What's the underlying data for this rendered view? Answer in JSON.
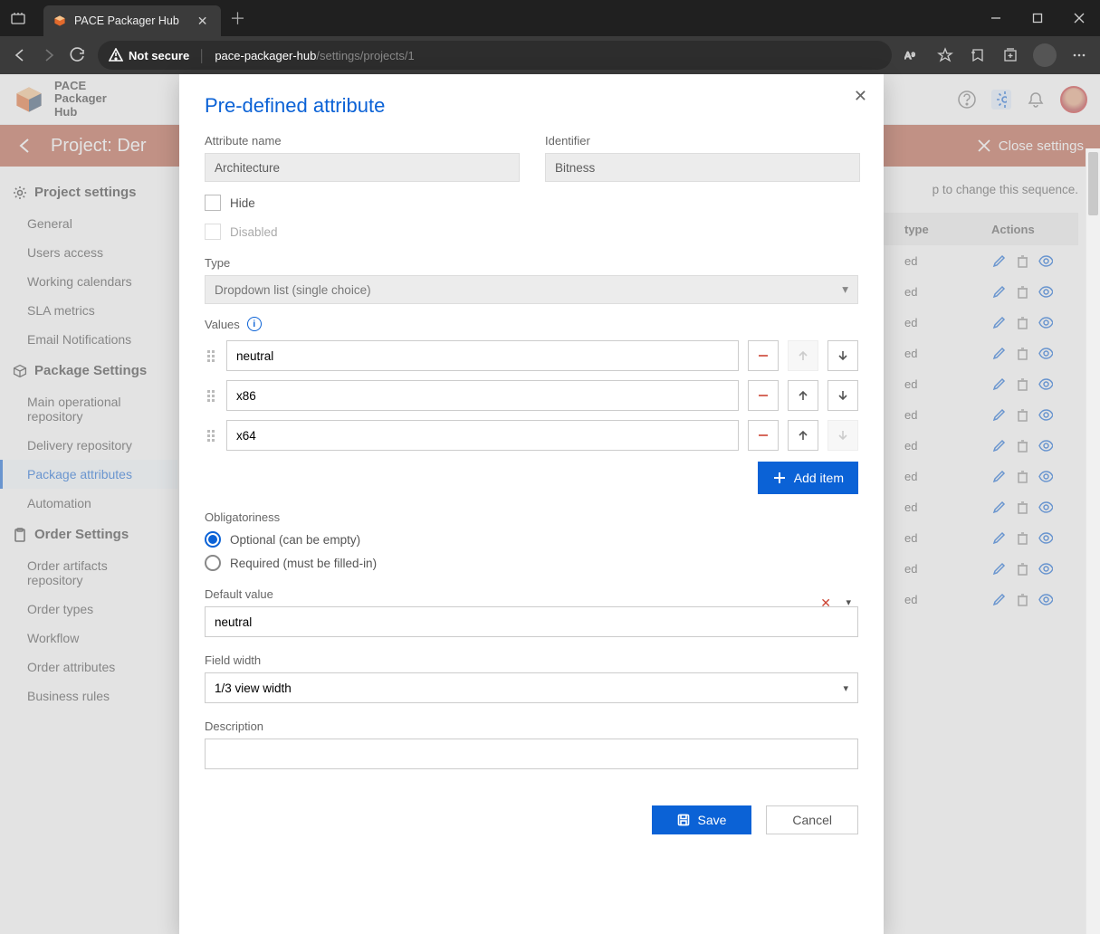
{
  "browser": {
    "tab_title": "PACE Packager Hub",
    "not_secure_label": "Not secure",
    "url_host": "pace-packager-hub",
    "url_path": "/settings/projects/1"
  },
  "app_header": {
    "logo_line1": "PACE",
    "logo_line2": "Packager",
    "logo_line3": "Hub"
  },
  "orange_bar": {
    "title": "Project: Der",
    "close_label": "Close settings"
  },
  "sidebar": {
    "sections": [
      {
        "title": "Project settings",
        "items": [
          "General",
          "Users access",
          "Working calendars",
          "SLA metrics",
          "Email Notifications"
        ]
      },
      {
        "title": "Package Settings",
        "items": [
          "Main operational repository",
          "Delivery repository",
          "Package attributes",
          "Automation"
        ],
        "active_index": 2
      },
      {
        "title": "Order Settings",
        "items": [
          "Order artifacts repository",
          "Order types",
          "Workflow",
          "Order attributes",
          "Business rules"
        ]
      }
    ]
  },
  "bg_main": {
    "hint_tail": "p to change this sequence.",
    "col_type": "type",
    "col_actions": "Actions",
    "row_value": "ed",
    "row_count": 12
  },
  "modal": {
    "title": "Pre-defined attribute",
    "labels": {
      "attr_name": "Attribute name",
      "identifier": "Identifier",
      "hide": "Hide",
      "disabled": "Disabled",
      "type": "Type",
      "values": "Values",
      "obligatoriness": "Obligatoriness",
      "opt": "Optional (can be empty)",
      "req": "Required (must be filled-in)",
      "default_value": "Default value",
      "field_width": "Field width",
      "description": "Description",
      "add_item": "Add item",
      "save": "Save",
      "cancel": "Cancel"
    },
    "values": {
      "attr_name": "Architecture",
      "identifier": "Bitness",
      "type_selected": "Dropdown list (single choice)",
      "value_items": [
        "neutral",
        "x86",
        "x64"
      ],
      "obligatoriness_selected": "optional",
      "default_value": "neutral",
      "field_width": "1/3 view width",
      "description": ""
    }
  }
}
